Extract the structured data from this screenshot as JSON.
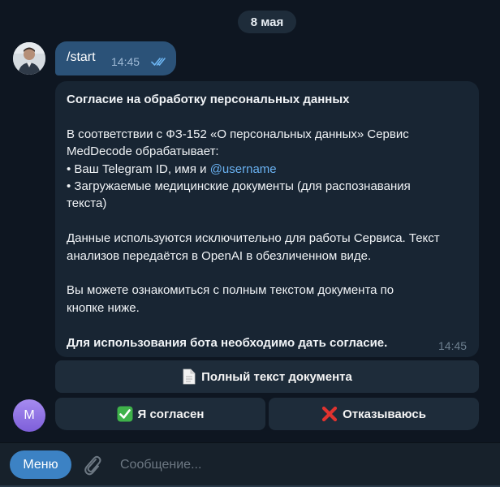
{
  "date_separator": "8 мая",
  "outgoing": {
    "text": "/start",
    "time": "14:45"
  },
  "bot_message": {
    "title": "Согласие на обработку персональных данных",
    "para1_line1": "В соответствии с ФЗ-152 «О персональных данных» Сервис",
    "para1_line2": "MedDecode обрабатывает:",
    "bullet1_prefix": "• Ваш Telegram ID, имя и ",
    "bullet1_link": "@username",
    "bullet2_line1": "• Загружаемые медицинские документы (для распознавания",
    "bullet2_line2": "текста)",
    "para2_line1": "Данные используются исключительно для работы Сервиса. Текст",
    "para2_line2": "анализов передаётся в OpenAI в обезличенном виде.",
    "para3_line1": "Вы можете ознакомиться с полным текстом документа по",
    "para3_line2": "кнопке ниже.",
    "closing": "Для использования бота необходимо дать согласие.",
    "time": "14:45"
  },
  "keyboard": {
    "full_text_label": "Полный текст документа",
    "agree_label": "Я согласен",
    "refuse_label": "Отказываюсь"
  },
  "bot_avatar_letter": "М",
  "composer": {
    "menu_label": "Меню",
    "placeholder": "Сообщение..."
  },
  "colors": {
    "background": "#0e1621",
    "outgoing_bubble": "#2b5278",
    "incoming_bubble": "#182533",
    "button": "#1e2c3a",
    "menu_button": "#3c82c4",
    "link": "#6ab2f2"
  },
  "icons": {
    "document": "page-facing-up-icon",
    "agree": "check-mark-button-icon",
    "refuse": "cross-mark-icon",
    "attach": "paperclip-icon",
    "read": "double-check-icon"
  }
}
